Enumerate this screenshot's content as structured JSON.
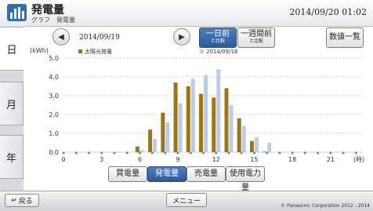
{
  "header": {
    "title": "発電量",
    "subtitle": "グラフ　発電量",
    "datetime": "2014/09/20  01:02"
  },
  "side_tabs": [
    "日",
    "月",
    "年"
  ],
  "nav": {
    "prev_icon": "◀",
    "next_icon": "▶",
    "date": "2014/09/19",
    "day_prev": {
      "label": "一日前",
      "sub": "と比較"
    },
    "week_prev": {
      "label": "一週間前",
      "sub": "と比較"
    },
    "values_list": "数値一覧"
  },
  "chart_data": {
    "type": "bar",
    "ylabel": "(kWh)",
    "xlabel": "(時)",
    "ylim": [
      0,
      5.0
    ],
    "yticks": [
      "5.0",
      "4.0",
      "3.0",
      "2.0",
      "1.0",
      "0.0"
    ],
    "xticks": [
      "0",
      "3",
      "6",
      "9",
      "12",
      "15",
      "18",
      "21"
    ],
    "hours": [
      6,
      7,
      8,
      9,
      10,
      11,
      12,
      13,
      14,
      15,
      16
    ],
    "series": [
      {
        "name": "太陽光発電",
        "color": "#a0740e",
        "values": [
          0.3,
          1.2,
          2.1,
          3.7,
          3.5,
          3.1,
          2.9,
          3.4,
          1.8,
          0.6,
          0.03
        ]
      },
      {
        "name": "2014/09/18",
        "color": "#b9cdea",
        "values": [
          0.1,
          0.7,
          1.6,
          2.6,
          3.9,
          4.1,
          4.4,
          2.5,
          1.4,
          0.8,
          0.5
        ]
      }
    ]
  },
  "tabs": [
    "買電量",
    "発電量",
    "売電量",
    "使用電力量"
  ],
  "footer": {
    "back": "戻る",
    "menu": "メニュー",
    "copyright": "© Panasonic Corporation 2012 - 2014"
  }
}
